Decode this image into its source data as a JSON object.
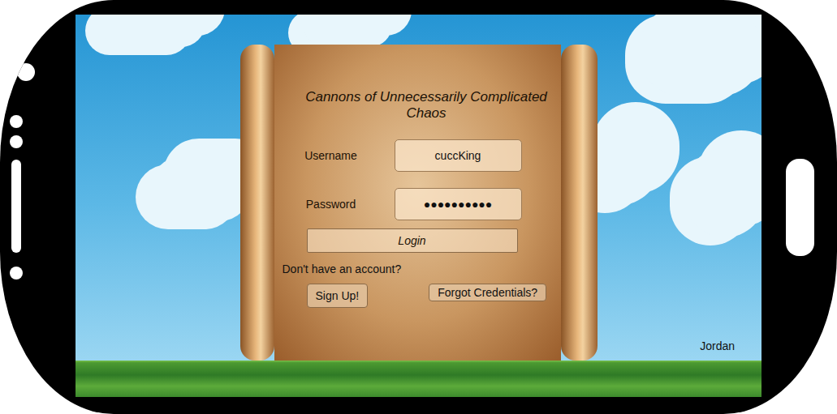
{
  "app": {
    "title": "Cannons of Unnecessarily Complicated Chaos",
    "author": "Jordan"
  },
  "form": {
    "fields": [
      {
        "label": "Username",
        "value": "cuccKing"
      },
      {
        "label": "Password",
        "value": "●●●●●●●●●●"
      }
    ],
    "login": "Login",
    "prompt": "Don't have an account?",
    "buttons": [
      "Sign Up!",
      "Forgot Credentials?"
    ]
  }
}
